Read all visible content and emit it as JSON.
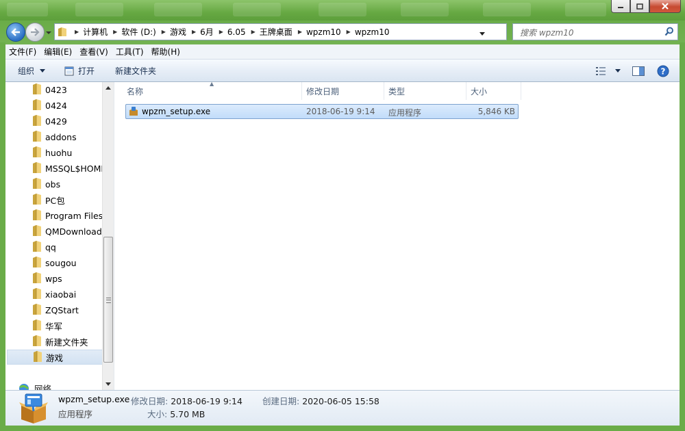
{
  "window": {
    "accent": "#6aac48",
    "caption_buttons": [
      "minimize-icon",
      "maximize-icon",
      "close-icon"
    ]
  },
  "address": {
    "crumbs": [
      "计算机",
      "软件 (D:)",
      "游戏",
      "6月",
      "6.05",
      "王牌桌面",
      "wpzm10",
      "wpzm10"
    ],
    "refresh_icon": "refresh-icon"
  },
  "search": {
    "placeholder": "搜索 wpzm10"
  },
  "menubar": {
    "items": [
      "文件(F)",
      "编辑(E)",
      "查看(V)",
      "工具(T)",
      "帮助(H)"
    ]
  },
  "toolbar": {
    "organize": "组织",
    "open": "打开",
    "new_folder": "新建文件夹"
  },
  "navpane": {
    "folders": [
      {
        "label": "0423"
      },
      {
        "label": "0424"
      },
      {
        "label": "0429"
      },
      {
        "label": "addons"
      },
      {
        "label": "huohu"
      },
      {
        "label": "MSSQL$HOME"
      },
      {
        "label": "obs"
      },
      {
        "label": "PC包"
      },
      {
        "label": "Program Files"
      },
      {
        "label": "QMDownload"
      },
      {
        "label": "qq"
      },
      {
        "label": "sougou"
      },
      {
        "label": "wps"
      },
      {
        "label": "xiaobai"
      },
      {
        "label": "ZQStart"
      },
      {
        "label": "华军"
      },
      {
        "label": "新建文件夹"
      },
      {
        "label": "游戏",
        "selected": true
      }
    ],
    "network": "网络"
  },
  "columns": {
    "name": "名称",
    "date": "修改日期",
    "type": "类型",
    "size": "大小"
  },
  "files": [
    {
      "name": "wpzm_setup.exe",
      "date": "2018-06-19 9:14",
      "type": "应用程序",
      "size": "5,846 KB",
      "icon": "setup-icon"
    }
  ],
  "details": {
    "name": "wpzm_setup.exe",
    "kind": "应用程序",
    "modified_label": "修改日期:",
    "modified_value": "2018-06-19 9:14",
    "size_label": "大小:",
    "size_value": "5.70 MB",
    "created_label": "创建日期:",
    "created_value": "2020-06-05 15:58"
  }
}
